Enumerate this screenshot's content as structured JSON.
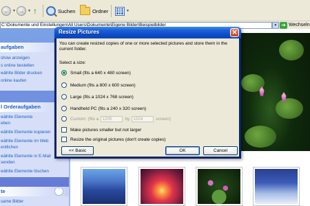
{
  "toolbar": {
    "search_label": "Suchen",
    "folders_label": "Ordner"
  },
  "address": {
    "path": "C:\\Dokumente und Einstellungen\\All Users\\Dokumente\\Eigene Bilder\\Beispielbilder",
    "go_label": "Wechseln"
  },
  "taskpane": {
    "picture_tasks": {
      "title": "aufgaben",
      "links": [
        "show anzeigen",
        "s online bestellen",
        "wählte Bilder drucken",
        "online kaufen"
      ]
    },
    "folder_tasks": {
      "title": "l Orderaufgaben",
      "links": [
        "wählte Elemente",
        "eben",
        "wählte Elemente kopieren",
        "wählte Elemente im Web",
        "entlichen",
        "wählte Elemente in E-Mail",
        "senden",
        "wählte Elemente löschen"
      ]
    },
    "other_places": {
      "title": "te",
      "links": [
        "same Bilder"
      ]
    }
  },
  "dialog": {
    "title": "Resize Pictures",
    "intro": "You can create resized copies of one or more selected pictures and store them in the current folder.",
    "select_label": "Select a size:",
    "sizes": [
      {
        "label": "Small (fits a 640 x 480 screen)",
        "selected": true
      },
      {
        "label": "Medium (fits a 800 x 600 screen)",
        "selected": false
      },
      {
        "label": "Large (fits a 1024 x 768 screen)",
        "selected": false
      },
      {
        "label": "Handheld PC (fits a 240 x 320 screen)",
        "selected": false
      }
    ],
    "custom": {
      "label": "Custom",
      "fits_a": "(fits a",
      "width": "1200",
      "by": "by",
      "height": "1024",
      "screen": "screen)"
    },
    "options": [
      {
        "label": "Make pictures smaller but not larger",
        "checked": false
      },
      {
        "label": "Resize the original pictures (don't create copies)",
        "checked": false
      }
    ],
    "buttons": {
      "basic": "<< Basic",
      "ok": "OK",
      "cancel": "Cancel"
    }
  },
  "colors": {
    "title_blue": "#0a4cc7",
    "link_blue": "#215dc6",
    "dialog_face": "#ece9d8",
    "taskpane_blue": "#7ba2e7"
  }
}
